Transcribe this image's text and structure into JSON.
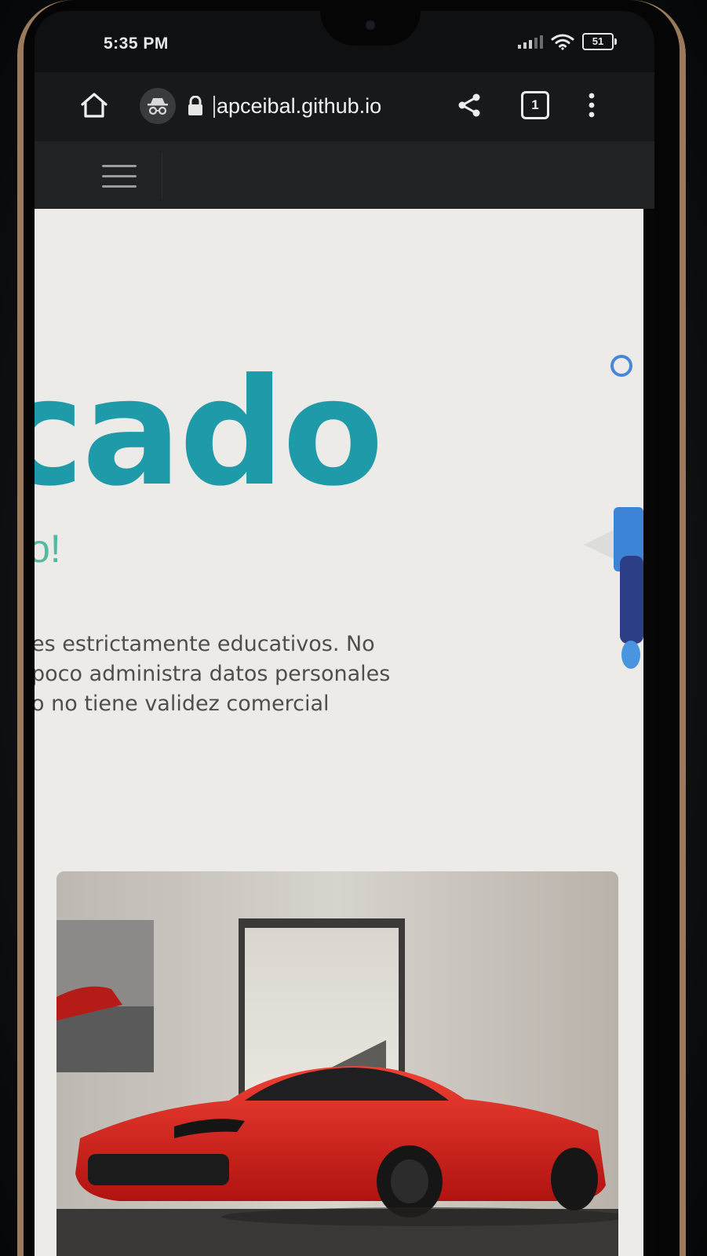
{
  "status_bar": {
    "time": "5:35 PM",
    "battery": "51",
    "icons": [
      "signal-icon",
      "wifi-icon",
      "battery-icon"
    ]
  },
  "browser": {
    "url": "apceibal.github.io",
    "tab_count": "1",
    "icons": [
      "home-icon",
      "incognito-icon",
      "lock-icon",
      "share-icon",
      "tabs-icon",
      "more-vert-icon"
    ]
  },
  "site_nav": {
    "menu_icon": "hamburger-icon"
  },
  "hero": {
    "headline": "cado",
    "subhead": "o!",
    "disclaimer_lines": [
      "es estrictamente educativos. No",
      "poco administra datos personales",
      "o no tiene validez comercial"
    ]
  },
  "image_card": {
    "subject": "red-sports-car-photo"
  },
  "colors": {
    "headline": "#1f9aa8",
    "subhead": "#52b9a4",
    "body_text": "#4e4e4e",
    "page_bg": "#ecebe7",
    "toolbar_bg": "#18191b",
    "nav_bg": "#212224",
    "accent_blue": "#4a86d8"
  }
}
